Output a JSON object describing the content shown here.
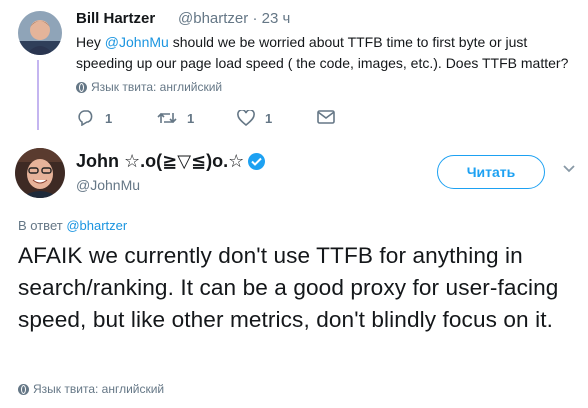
{
  "reply_tweet": {
    "author_name": "Bill Hartzer",
    "author_handle": "@bhartzer",
    "time": "· 23 ч",
    "text_prefix": "Hey ",
    "mention": "@JohnMu",
    "text_suffix": " should we be worried about TTFB time to first byte or just speeding up our page load speed ( the code, images, etc.). Does TTFB matter?",
    "language_note": "Язык твита: английский",
    "actions": {
      "reply_count": "1",
      "retweet_count": "1",
      "like_count": "1"
    }
  },
  "main_tweet": {
    "author_name": "John ☆.o(≧▽≦)o.☆",
    "author_handle": "@JohnMu",
    "follow_label": "Читать",
    "reply_to_prefix": "В ответ ",
    "reply_to_handle": "@bhartzer",
    "text": "AFAIK we currently don't use TTFB for anything in search/ranking. It can be a good proxy for user-facing speed, but like other metrics, don't blindly focus on it.",
    "language_note": "Язык твита: английский"
  },
  "icons": [
    "reply-icon",
    "retweet-icon",
    "like-icon",
    "dm-icon",
    "verified-icon",
    "chevron-down-icon",
    "globe-icon"
  ],
  "colors": {
    "link": "#1b95e0",
    "accent": "#1da1f2",
    "muted": "#657786",
    "thread_line": "#c4b5f0"
  }
}
